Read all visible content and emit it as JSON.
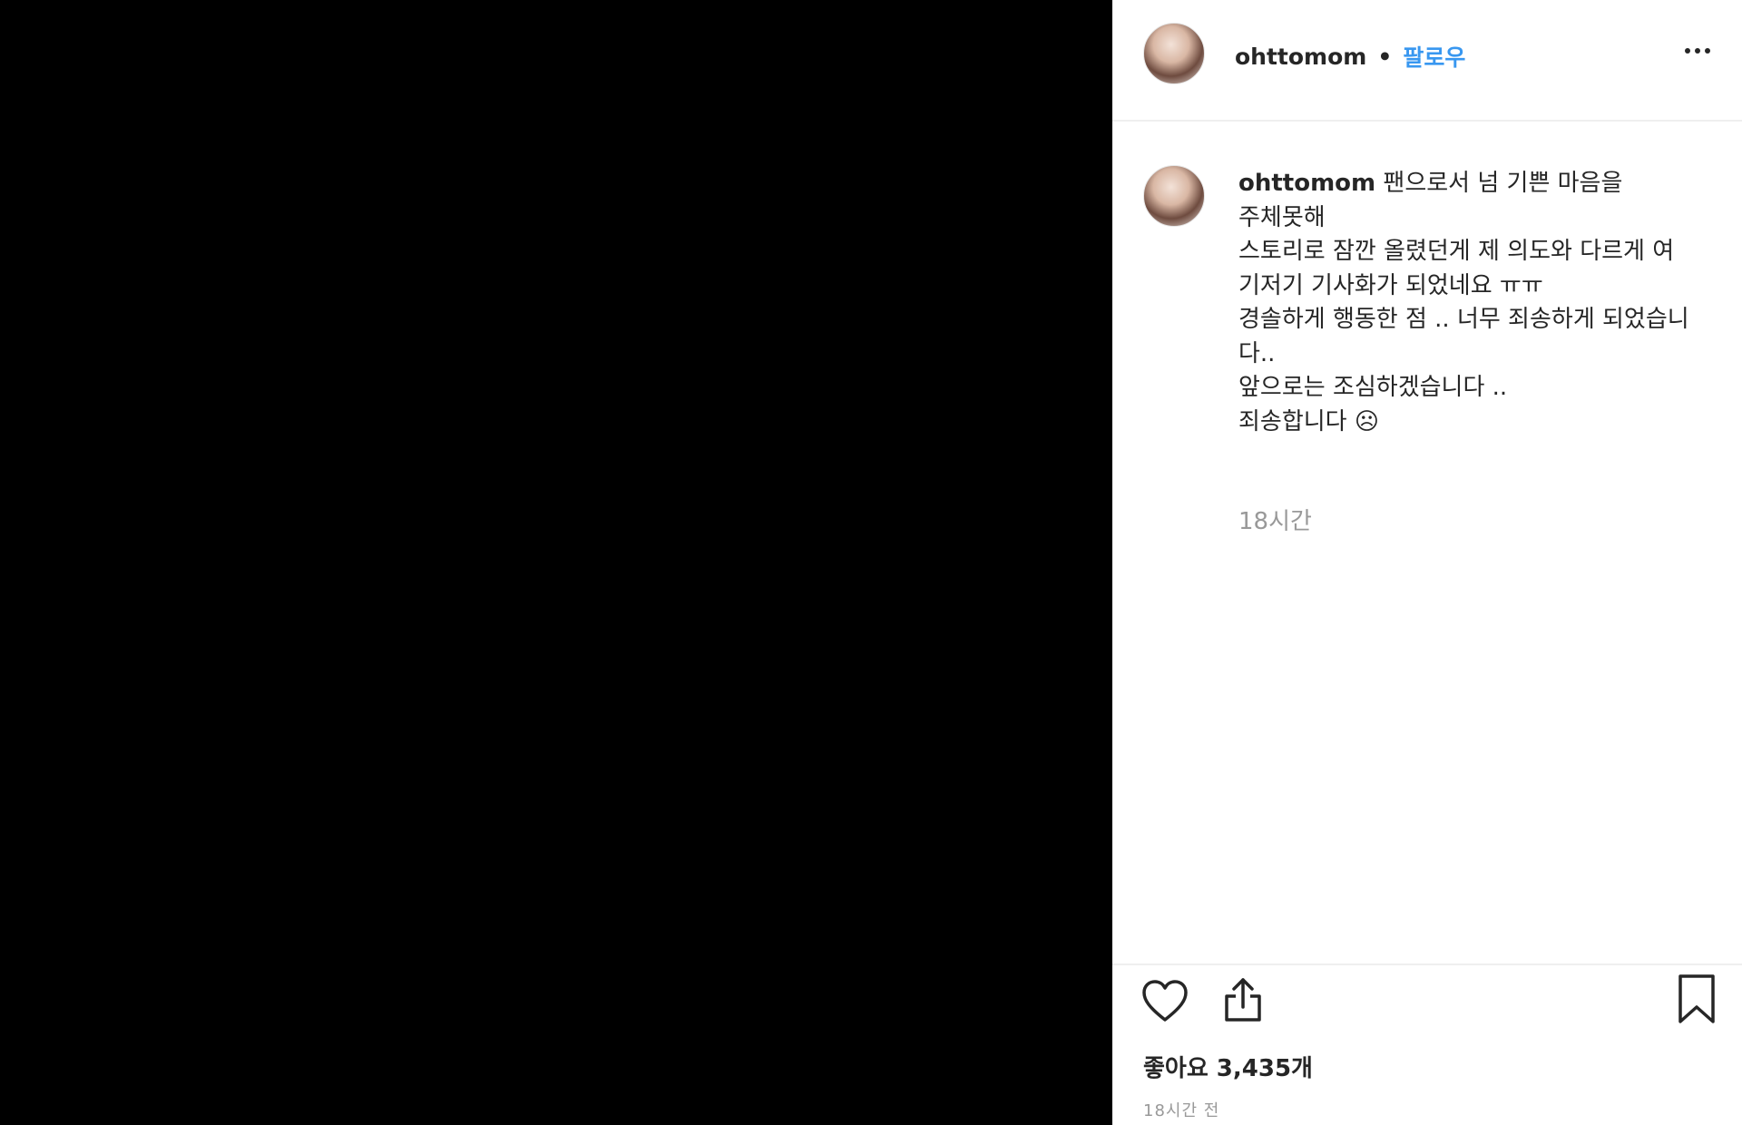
{
  "header": {
    "username": "ohttomom",
    "separator": "•",
    "follow_label": "팔로우"
  },
  "caption": {
    "username": "ohttomom",
    "text": "팬으로서 넘 기쁜 마음을\n주체못해\n스토리로 잠깐 올렸던게 제 의도와 다르게 여기저기 기사화가 되었네요 ㅠㅠ\n경솔하게 행동한 점 .. 너무 죄송하게 되었습니다..\n앞으로는 조심하겠습니다 ..\n죄송합니다 ☹",
    "time": "18시간"
  },
  "actions": {
    "like_icon": "heart-icon",
    "share_icon": "share-icon",
    "save_icon": "bookmark-icon"
  },
  "likes_text": "좋아요 3,435개",
  "posted_time": "18시간 전",
  "colors": {
    "link": "#3897f0",
    "text": "#262626",
    "muted": "#999999"
  }
}
